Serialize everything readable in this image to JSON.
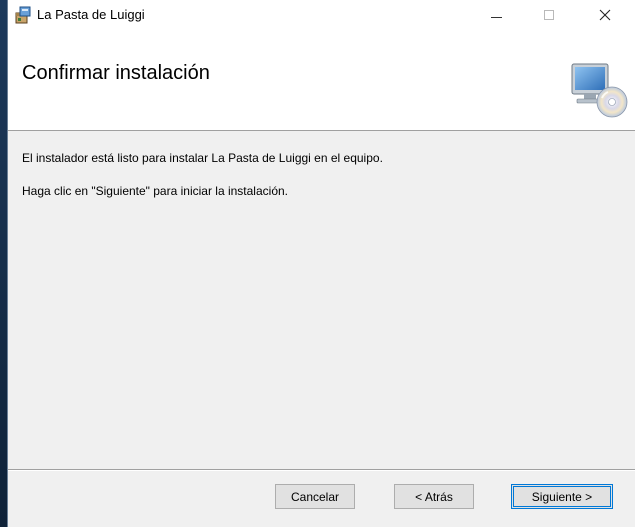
{
  "window": {
    "title": "La Pasta de Luiggi",
    "icon": "installer-package-icon",
    "controls": {
      "minimize": "minimize-icon",
      "maximize": "maximize-icon",
      "close": "close-icon"
    }
  },
  "header": {
    "title": "Confirmar instalación",
    "icon": "computer-cd-icon"
  },
  "body": {
    "line1": "El instalador está listo para instalar La Pasta de Luiggi en el equipo.",
    "line2": "Haga clic en \"Siguiente\" para iniciar la instalación."
  },
  "buttons": {
    "cancel": "Cancelar",
    "back": "< Atrás",
    "next": "Siguiente >"
  },
  "colors": {
    "accent": "#0078d7",
    "window_background": "#f0f0f0",
    "header_background": "#ffffff"
  }
}
